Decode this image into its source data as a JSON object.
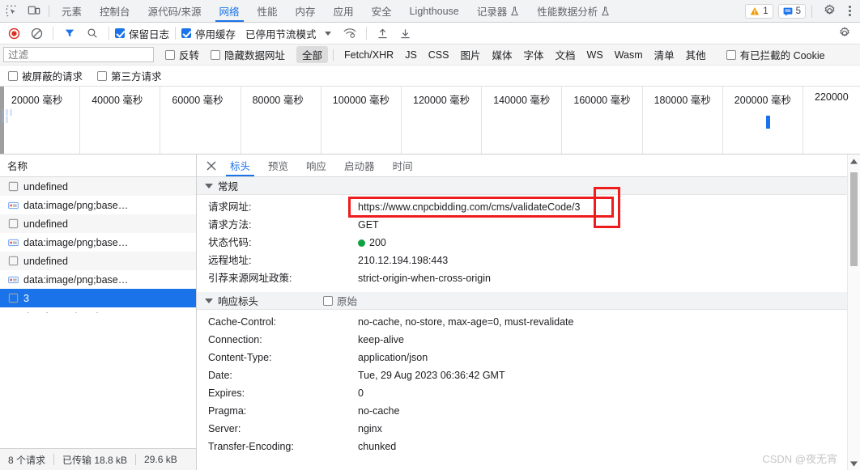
{
  "main_tabs": {
    "inspect_icon": "inspect-element-icon",
    "device_icon": "device-toolbar-icon",
    "items": [
      {
        "label": "元素",
        "active": false,
        "flask": false
      },
      {
        "label": "控制台",
        "active": false,
        "flask": false
      },
      {
        "label": "源代码/来源",
        "active": false,
        "flask": false
      },
      {
        "label": "网络",
        "active": true,
        "flask": false
      },
      {
        "label": "性能",
        "active": false,
        "flask": false
      },
      {
        "label": "内存",
        "active": false,
        "flask": false
      },
      {
        "label": "应用",
        "active": false,
        "flask": false
      },
      {
        "label": "安全",
        "active": false,
        "flask": false
      },
      {
        "label": "Lighthouse",
        "active": false,
        "flask": false
      },
      {
        "label": "记录器",
        "active": false,
        "flask": true
      },
      {
        "label": "性能数据分析",
        "active": false,
        "flask": true
      }
    ],
    "warning_count": "1",
    "message_count": "5",
    "settings_icon": "gear-icon",
    "more_icon": "more-vertical-icon"
  },
  "network_toolbar": {
    "record_icon": "record-circle-icon",
    "clear_icon": "clear-prohibited-icon",
    "filter_icon": "filter-funnel-icon",
    "search_icon": "search-icon",
    "preserve_log_label": "保留日志",
    "preserve_log_checked": true,
    "disable_cache_label": "停用缓存",
    "disable_cache_checked": true,
    "throttle_label": "已停用节流模式",
    "wifi_icon": "network-conditions-icon",
    "import_icon": "import-har-icon",
    "export_icon": "export-har-icon",
    "settings_icon": "gear-icon"
  },
  "filter_bar": {
    "filter_placeholder": "过滤",
    "filter_value": "",
    "invert_label": "反转",
    "invert_checked": false,
    "hide_data_urls_label": "隐藏数据网址",
    "hide_data_urls_checked": false,
    "types": [
      "全部",
      "Fetch/XHR",
      "JS",
      "CSS",
      "图片",
      "媒体",
      "字体",
      "文档",
      "WS",
      "Wasm",
      "清单",
      "其他"
    ],
    "selected_type": "全部",
    "blocked_cookies_label": "有已拦截的 Cookie",
    "blocked_cookies_checked": false,
    "blocked_requests_label": "被屏蔽的请求",
    "blocked_requests_checked": false,
    "third_party_label": "第三方请求",
    "third_party_checked": false
  },
  "overview": {
    "ticks": [
      "20000 毫秒",
      "40000 毫秒",
      "60000 毫秒",
      "80000 毫秒",
      "100000 毫秒",
      "120000 毫秒",
      "140000 毫秒",
      "160000 毫秒",
      "180000 毫秒",
      "200000 毫秒",
      "220000"
    ]
  },
  "requests": {
    "column_header": "名称",
    "rows": [
      {
        "name": "undefined",
        "icon": "document-icon",
        "selected": false
      },
      {
        "name": "data:image/png;base…",
        "icon": "image-icon",
        "selected": false
      },
      {
        "name": "undefined",
        "icon": "document-icon",
        "selected": false
      },
      {
        "name": "data:image/png;base…",
        "icon": "image-icon",
        "selected": false
      },
      {
        "name": "undefined",
        "icon": "document-icon",
        "selected": false
      },
      {
        "name": "data:image/png;base…",
        "icon": "image-icon",
        "selected": false
      },
      {
        "name": "3",
        "icon": "document-icon",
        "selected": true
      },
      {
        "name": "data:image/png;base…",
        "icon": "image-icon",
        "selected": false
      }
    ]
  },
  "status_bar": {
    "requests_count": "8 个请求",
    "transferred": "已传输 18.8 kB",
    "resources": "29.6 kB"
  },
  "details": {
    "close_icon": "close-icon",
    "tabs": [
      {
        "label": "标头",
        "active": true
      },
      {
        "label": "预览",
        "active": false
      },
      {
        "label": "响应",
        "active": false
      },
      {
        "label": "启动器",
        "active": false
      },
      {
        "label": "时间",
        "active": false
      }
    ],
    "general": {
      "title": "常规",
      "rows": [
        {
          "key": "请求网址:",
          "value": "https://www.cnpcbidding.com/cms/validateCode/3",
          "highlight": true
        },
        {
          "key": "请求方法:",
          "value": "GET",
          "highlight": false
        },
        {
          "key": "状态代码:",
          "value": "200",
          "status_dot": "#11a143",
          "highlight": false
        },
        {
          "key": "远程地址:",
          "value": "210.12.194.198:443",
          "highlight": false
        },
        {
          "key": "引荐来源网址政策:",
          "value": "strict-origin-when-cross-origin",
          "highlight": false
        }
      ]
    },
    "response_headers": {
      "title": "响应标头",
      "raw_label": "原始",
      "raw_checked": false,
      "rows": [
        {
          "key": "Cache-Control:",
          "value": "no-cache, no-store, max-age=0, must-revalidate"
        },
        {
          "key": "Connection:",
          "value": "keep-alive"
        },
        {
          "key": "Content-Type:",
          "value": "application/json"
        },
        {
          "key": "Date:",
          "value": "Tue, 29 Aug 2023 06:36:42 GMT"
        },
        {
          "key": "Expires:",
          "value": "0"
        },
        {
          "key": "Pragma:",
          "value": "no-cache"
        },
        {
          "key": "Server:",
          "value": "nginx"
        },
        {
          "key": "Transfer-Encoding:",
          "value": "chunked"
        }
      ]
    }
  },
  "watermark": "CSDN @夜无宵"
}
